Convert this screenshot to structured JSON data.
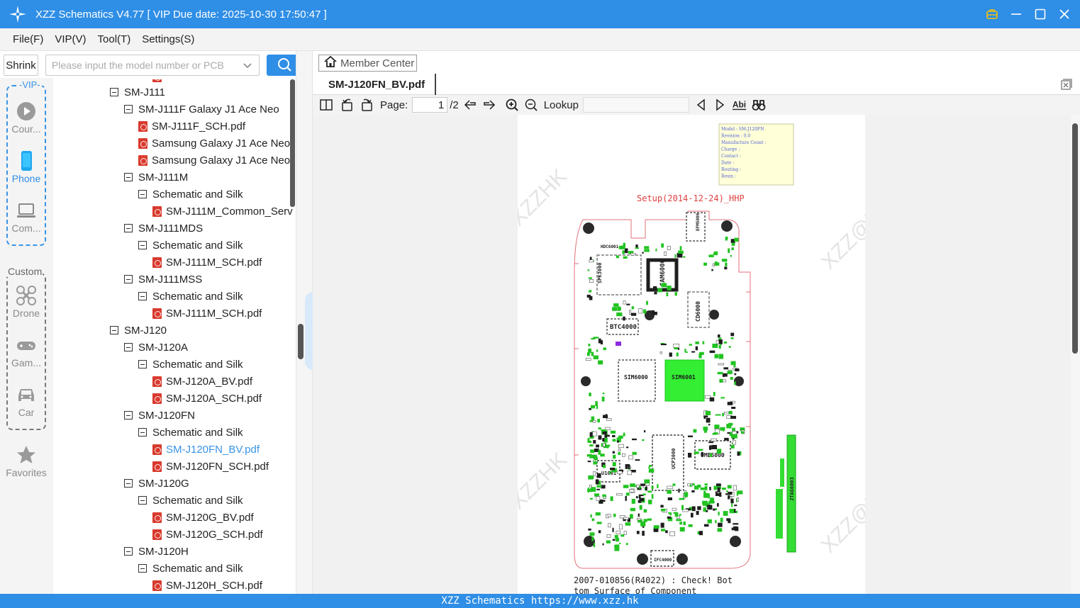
{
  "window": {
    "title": "XZZ Schematics V4.77 [ VIP Due date: 2025-10-30 17:50:47 ]"
  },
  "menu": [
    "File(F)",
    "VIP(V)",
    "Tool(T)",
    "Settings(S)"
  ],
  "toolbar": {
    "shrink_label": "Shrink",
    "search_placeholder": "Please input the model number or PCB",
    "member_center_label": "Member Center"
  },
  "rail": {
    "vip_label": "-VIP-",
    "custom_label": "Custom",
    "items": [
      {
        "label": "Cour...",
        "icon": "play-circle-icon"
      },
      {
        "label": "Phone",
        "icon": "phone-icon",
        "active": true
      },
      {
        "label": "Com...",
        "icon": "laptop-icon"
      },
      {
        "label": "Drone",
        "icon": "drone-icon"
      },
      {
        "label": "Gam...",
        "icon": "gamepad-icon"
      },
      {
        "label": "Car",
        "icon": "car-icon"
      },
      {
        "label": "Favorites",
        "icon": "star-icon"
      }
    ]
  },
  "tree": [
    {
      "label": "SM-J111",
      "type": "folder",
      "level": 0
    },
    {
      "label": "SM-J111F Galaxy J1 Ace Neo",
      "type": "folder",
      "level": 1
    },
    {
      "label": "SM-J111F_SCH.pdf",
      "type": "pdf",
      "level": 2
    },
    {
      "label": "Samsung Galaxy J1 Ace Neo",
      "type": "pdf",
      "level": 2
    },
    {
      "label": "Samsung Galaxy J1 Ace Neo",
      "type": "pdf",
      "level": 2
    },
    {
      "label": "SM-J111M",
      "type": "folder",
      "level": 1
    },
    {
      "label": "Schematic and Silk",
      "type": "folder",
      "level": 2
    },
    {
      "label": "SM-J111M_Common_Serv",
      "type": "pdf",
      "level": 3
    },
    {
      "label": "SM-J111MDS",
      "type": "folder",
      "level": 1
    },
    {
      "label": "Schematic and Silk",
      "type": "folder",
      "level": 2
    },
    {
      "label": "SM-J111M_SCH.pdf",
      "type": "pdf",
      "level": 3
    },
    {
      "label": "SM-J111MSS",
      "type": "folder",
      "level": 1
    },
    {
      "label": "Schematic and Silk",
      "type": "folder",
      "level": 2
    },
    {
      "label": "SM-J111M_SCH.pdf",
      "type": "pdf",
      "level": 3
    },
    {
      "label": "SM-J120",
      "type": "folder",
      "level": 0
    },
    {
      "label": "SM-J120A",
      "type": "folder",
      "level": 1
    },
    {
      "label": "Schematic and Silk",
      "type": "folder",
      "level": 2
    },
    {
      "label": "SM-J120A_BV.pdf",
      "type": "pdf",
      "level": 3
    },
    {
      "label": "SM-J120A_SCH.pdf",
      "type": "pdf",
      "level": 3
    },
    {
      "label": "SM-J120FN",
      "type": "folder",
      "level": 1
    },
    {
      "label": "Schematic and Silk",
      "type": "folder",
      "level": 2
    },
    {
      "label": "SM-J120FN_BV.pdf",
      "type": "pdf",
      "level": 3,
      "selected": true
    },
    {
      "label": "SM-J120FN_SCH.pdf",
      "type": "pdf",
      "level": 3
    },
    {
      "label": "SM-J120G",
      "type": "folder",
      "level": 1
    },
    {
      "label": "Schematic and Silk",
      "type": "folder",
      "level": 2
    },
    {
      "label": "SM-J120G_BV.pdf",
      "type": "pdf",
      "level": 3
    },
    {
      "label": "SM-J120G_SCH.pdf",
      "type": "pdf",
      "level": 3
    },
    {
      "label": "SM-J120H",
      "type": "folder",
      "level": 1
    },
    {
      "label": "Schematic and Silk",
      "type": "folder",
      "level": 2
    },
    {
      "label": "SM-J120H_SCH.pdf",
      "type": "pdf",
      "level": 3
    }
  ],
  "document": {
    "tab_label": "SM-J120FN_BV.pdf",
    "page_label": "Page:",
    "page_current": "1",
    "page_total": "/2",
    "lookup_label": "Lookup",
    "lookup_value": ""
  },
  "pdf_page": {
    "info_box": [
      "Model : SM-J120FN",
      "Revision : 0.0",
      "Manufacture Count :",
      "Charge :",
      "Contact :",
      "Date :",
      "Routing :",
      "Resin :"
    ],
    "setup_text": "Setup(2014-12-24)_HHP",
    "watermark": "XZZ@XZZHK",
    "footer_line1": "2007-010856(R4022) : Check!  Bot",
    "footer_line2": "tom Surface of Component",
    "components": [
      "HDC6001",
      "EFM5000",
      "SPK3000",
      "CAM6000",
      "CD6000",
      "BTC4000",
      "SIM6000",
      "SIM6001",
      "UCP3000",
      "UME5000",
      "U1001",
      "IFC4000",
      "JTAG6003"
    ],
    "colors": {
      "outline": "#e0707a",
      "pad": "#22c322",
      "component": "#1e1e1e",
      "highlight": "#33ee33"
    }
  },
  "status": {
    "text": "XZZ Schematics https://www.xzz.hk"
  }
}
